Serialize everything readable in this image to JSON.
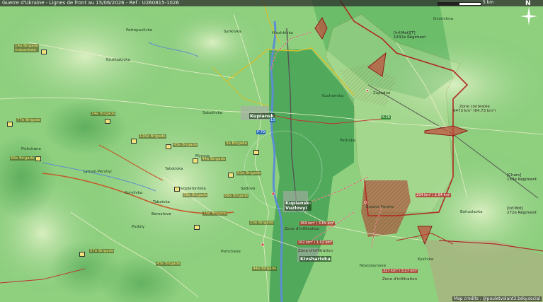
{
  "header": {
    "title": "Guerre d'Ukraine - Lignes de front au 15/06/2026 - Ref : U260815-1026"
  },
  "scale": {
    "label": "5 km"
  },
  "compass": {
    "north": "N"
  },
  "places": {
    "kupiansk": "Kupiansk",
    "kupiansk_vuzlovyi": "Kupiansk-\nVuzlovyi",
    "kivsharivka": "Kivsharivka",
    "petropavlivka": "Petropavlivka",
    "soboliivka": "Soboliivka",
    "kucherivka": "Kucherivka",
    "pishchane": "Pishchane",
    "yatskivka": "Yatskivka",
    "novoosynove": "Novoosynove",
    "podoly": "Podoly",
    "lyman_pershyi": "Lyman Pershyi",
    "tabaivka": "Tabaivka",
    "synkivka": "Synkivka",
    "kruhliakivka": "Kruhliakivka",
    "hlushkivka": "Hlushkivka",
    "zapadne": "Zapadne",
    "krasne_pershe": "Krasne Pershe",
    "kurylivka": "Kurylivka",
    "berestove": "Berestove",
    "pishchane_2": "Pishchane",
    "bohuslavka": "Bohuslavka",
    "novoplatonivka": "Novoplatonivka",
    "dvorichna": "Dvorichna",
    "kyslivka": "Kyslivka",
    "sadove": "Sadove",
    "petrivka": "Petrivka",
    "myrove": "Myrove"
  },
  "roads": {
    "p79": "P-79",
    "h26": "H-26",
    "t2": "13"
  },
  "zones": {
    "contested": "Zone contestée\n6473 km² (64.73 km²)",
    "exfil_1": "Zone d'infiltration",
    "exfil_2": "Zone d'infiltration",
    "exfil_3": "Zone d'infiltration"
  },
  "distances": {
    "d1": "294 km² / 2.94 km²",
    "d2": "369 km² / 3.69 km²",
    "d3": "102 km² / 1.02 km²",
    "d4": "327 km² / 3.27 km²"
  },
  "units_ua": [
    "14e Brigade\nmécanisée",
    "14e Brigade",
    "116e Brigade",
    "77e Brigade",
    "68e Brigade",
    "43e Brigade",
    "44e Brigade",
    "3e Brigade",
    "92e Brigade",
    "58e Brigade",
    "66e Brigade",
    "10e Brigade",
    "23e Brigade",
    "57e Brigade"
  ],
  "units_ru": [
    "[Inf.Mot][T]\n1432e Régiment",
    "[Chars]\n153e Régiment",
    "[Inf.Mot]\n272e Régiment"
  ],
  "credit": "Map credits : @pouletvolant3.bsky.social",
  "colors": {
    "ua_front": "#d8c02a",
    "ru_front": "#b02a24",
    "ru_zone": "#b03a30",
    "river": "#5d8ecf"
  }
}
